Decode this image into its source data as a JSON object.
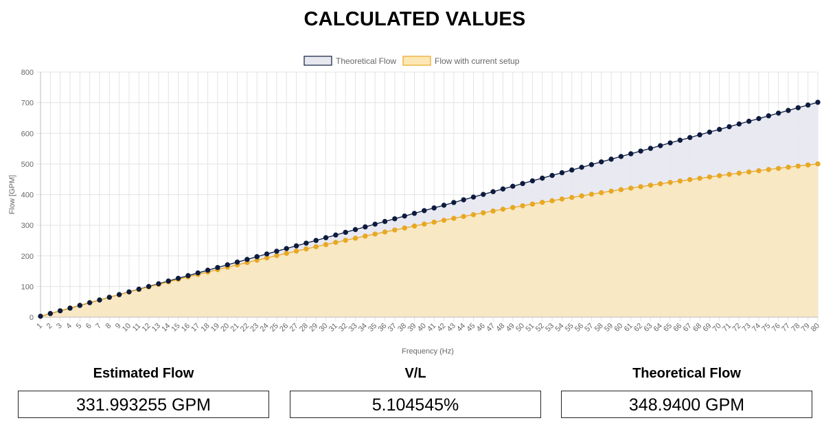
{
  "page": {
    "title": "CALCULATED VALUES"
  },
  "chart_data": {
    "type": "area",
    "title": "",
    "xlabel": "Frequency (Hz)",
    "ylabel": "Flow [GPM]",
    "x": [
      1,
      2,
      3,
      4,
      5,
      6,
      7,
      8,
      9,
      10,
      11,
      12,
      13,
      14,
      15,
      16,
      17,
      18,
      19,
      20,
      21,
      22,
      23,
      24,
      25,
      26,
      27,
      28,
      29,
      30,
      31,
      32,
      33,
      34,
      35,
      36,
      37,
      38,
      39,
      40,
      41,
      42,
      43,
      44,
      45,
      46,
      47,
      48,
      49,
      50,
      51,
      52,
      53,
      54,
      55,
      56,
      57,
      58,
      59,
      60,
      61,
      62,
      63,
      64,
      65,
      66,
      67,
      68,
      69,
      70,
      71,
      72,
      73,
      74,
      75,
      76,
      77,
      78,
      79,
      80
    ],
    "ylim": [
      0,
      800
    ],
    "yticks": [
      0,
      100,
      200,
      300,
      400,
      500,
      600,
      700,
      800
    ],
    "grid": true,
    "legend_position": "top",
    "series": [
      {
        "name": "Theoretical Flow",
        "color": "#0d1b3e",
        "fill": "#e6e7ef",
        "start": 3.0,
        "slope": 8.84
      },
      {
        "name": "Flow with current setup",
        "color": "#e8a823",
        "fill": "#fde7b4",
        "start": 3.0,
        "slope": 9.1,
        "curve": 0.0355
      }
    ]
  },
  "stats": {
    "estimated_flow": {
      "label": "Estimated Flow",
      "value": "331.993255 GPM"
    },
    "vl": {
      "label": "V/L",
      "value": "5.104545%"
    },
    "theoretical_flow": {
      "label": "Theoretical Flow",
      "value": "348.9400 GPM"
    }
  }
}
